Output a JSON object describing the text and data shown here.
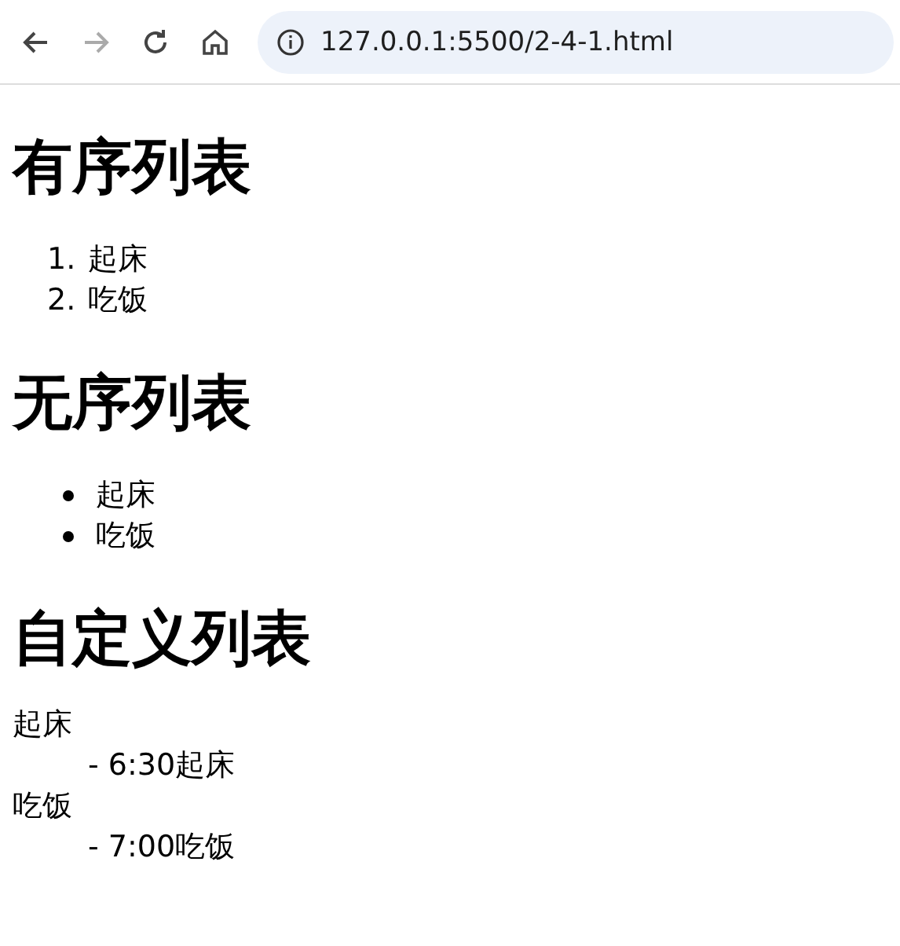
{
  "browser": {
    "back_enabled": true,
    "forward_enabled": false,
    "url": "127.0.0.1:5500/2-4-1.html"
  },
  "sections": [
    {
      "kind": "ordered",
      "heading": "有序列表",
      "items": [
        {
          "marker": "1.",
          "text": "起床"
        },
        {
          "marker": "2.",
          "text": "吃饭"
        }
      ]
    },
    {
      "kind": "unordered",
      "heading": "无序列表",
      "items": [
        {
          "text": "起床"
        },
        {
          "text": "吃饭"
        }
      ]
    },
    {
      "kind": "definition",
      "heading": "自定义列表",
      "items": [
        {
          "term": "起床",
          "description": "- 6:30起床"
        },
        {
          "term": "吃饭",
          "description": "- 7:00吃饭"
        }
      ]
    }
  ]
}
